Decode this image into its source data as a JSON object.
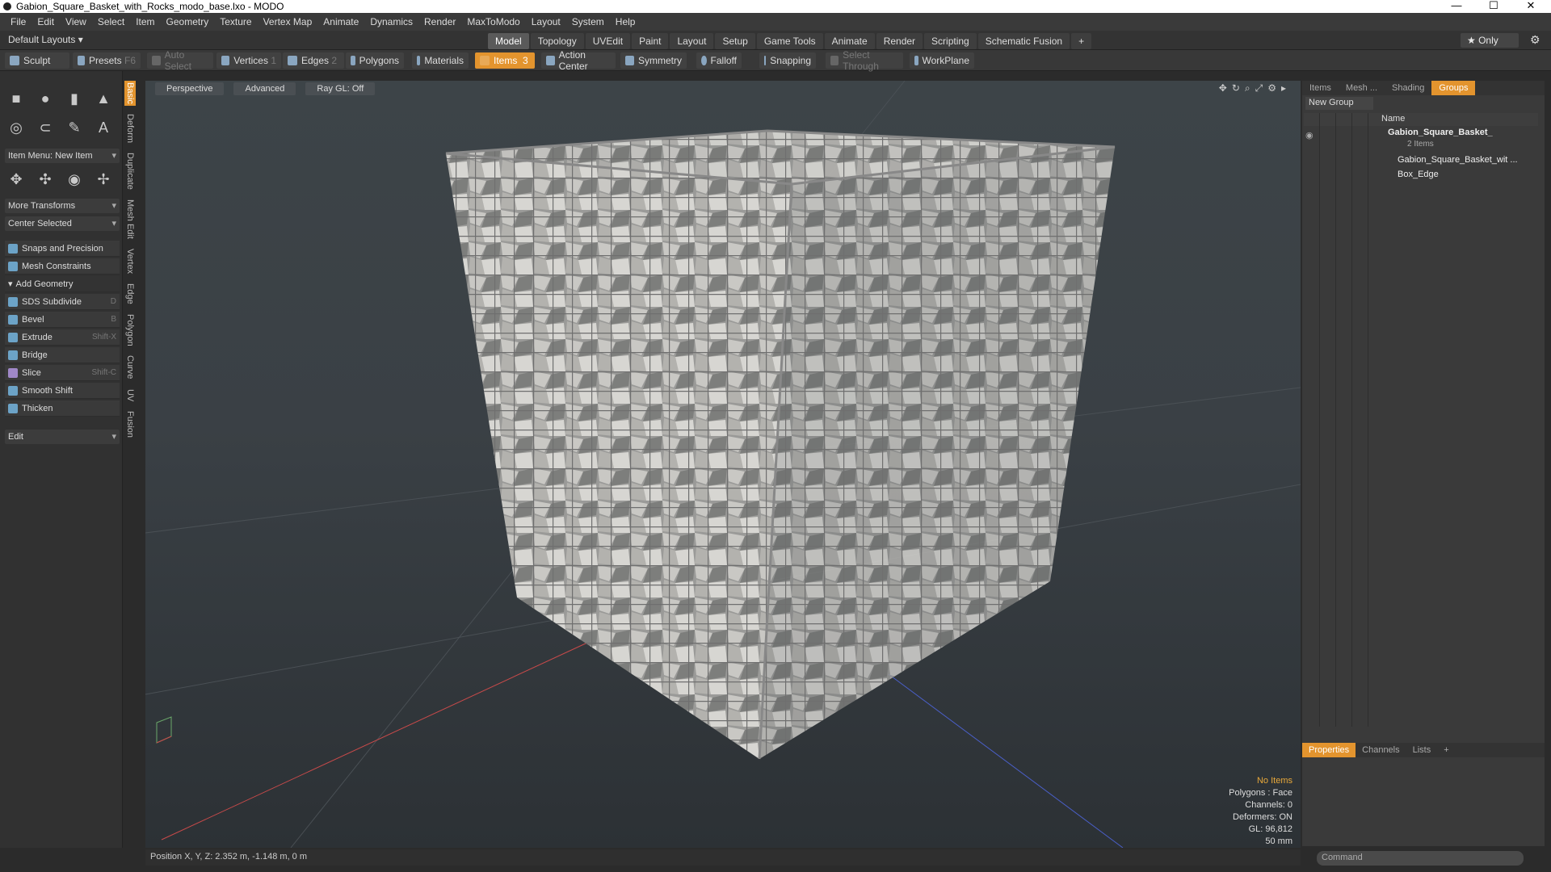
{
  "window": {
    "title": "Gabion_Square_Basket_with_Rocks_modo_base.lxo - MODO"
  },
  "menu": [
    "File",
    "Edit",
    "View",
    "Select",
    "Item",
    "Geometry",
    "Texture",
    "Vertex Map",
    "Animate",
    "Dynamics",
    "Render",
    "MaxToModo",
    "Layout",
    "System",
    "Help"
  ],
  "layout": {
    "name": "Default Layouts ▾",
    "tabs": [
      "Model",
      "Topology",
      "UVEdit",
      "Paint",
      "Layout",
      "Setup",
      "Game Tools",
      "Animate",
      "Render",
      "Scripting",
      "Schematic Fusion"
    ],
    "only": "★ Only"
  },
  "toolbar": {
    "sculpt": "Sculpt",
    "presets": "Presets",
    "auto_select": "Auto Select",
    "vertices": "Vertices",
    "edges": "Edges",
    "polygons": "Polygons",
    "materials": "Materials",
    "items": "Items",
    "action_center": "Action Center",
    "symmetry": "Symmetry",
    "falloff": "Falloff",
    "snapping": "Snapping",
    "select_through": "Select Through",
    "workplane": "WorkPlane",
    "f6": "F6",
    "n1": "1",
    "n2": "2",
    "n3": "3"
  },
  "left": {
    "item_menu": "Item Menu: New Item",
    "more_transforms": "More Transforms",
    "center_selected": "Center Selected",
    "snaps": "Snaps and Precision",
    "mesh_constraints": "Mesh Constraints",
    "add_geometry": "Add Geometry",
    "tools": [
      {
        "label": "SDS Subdivide",
        "shortcut": "D"
      },
      {
        "label": "Bevel",
        "shortcut": "B"
      },
      {
        "label": "Extrude",
        "shortcut": "Shift-X"
      },
      {
        "label": "Bridge",
        "shortcut": ""
      },
      {
        "label": "Slice",
        "shortcut": "Shift-C"
      },
      {
        "label": "Smooth Shift",
        "shortcut": ""
      },
      {
        "label": "Thicken",
        "shortcut": ""
      }
    ],
    "edit": "Edit",
    "vtabs": [
      "Basic",
      "Deform",
      "Duplicate",
      "Mesh Edit",
      "Vertex",
      "Edge",
      "Polygon",
      "Curve",
      "UV",
      "Fusion"
    ]
  },
  "viewport": {
    "view": "Perspective",
    "shading": "Advanced",
    "raygl": "Ray GL: Off",
    "stats": {
      "items": "No Items",
      "polygons": "Polygons : Face",
      "channels": "Channels: 0",
      "deformers": "Deformers: ON",
      "gl": "GL: 96,812",
      "scale": "50 mm"
    }
  },
  "status": {
    "position": "Position X, Y, Z:  2.352 m, -1.148 m, 0 m"
  },
  "right": {
    "tabs": [
      "Items",
      "Mesh ...",
      "Shading",
      "Groups"
    ],
    "new_group": "New Group",
    "name_header": "Name",
    "group": "Gabion_Square_Basket_",
    "count": "2 Items",
    "child1": "Gabion_Square_Basket_wit ...",
    "child2": "Box_Edge"
  },
  "props": {
    "tabs": [
      "Properties",
      "Channels",
      "Lists"
    ]
  },
  "command": {
    "placeholder": "Command"
  }
}
